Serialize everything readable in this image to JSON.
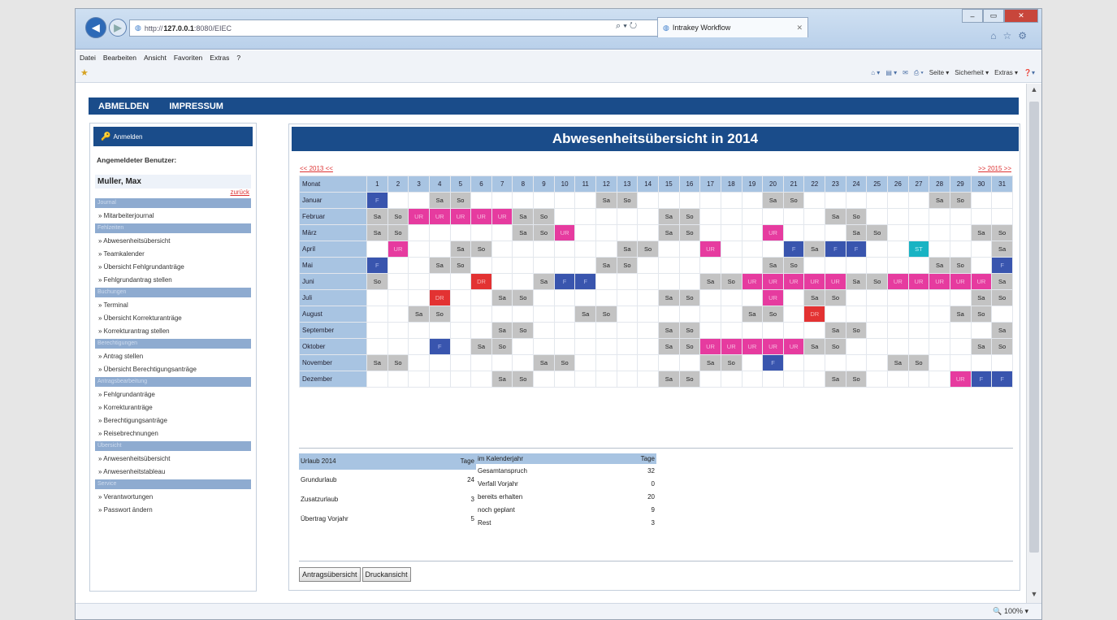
{
  "browser": {
    "url_prefix": "http://",
    "url_host": "127.0.0.1",
    "url_path": ":8080/EIEC",
    "tab_title": "Intrakey Workflow",
    "zoom": "100%"
  },
  "menu": [
    "Datei",
    "Bearbeiten",
    "Ansicht",
    "Favoriten",
    "Extras",
    "?"
  ],
  "commandbar": [
    "Seite ▾",
    "Sicherheit ▾",
    "Extras ▾"
  ],
  "topnav": [
    "ABMELDEN",
    "IMPRESSUM"
  ],
  "sidebar": {
    "header": "Anmelden",
    "user_label": "Angemeldeter Benutzer:",
    "user_name": "Muller, Max",
    "back_link": "zurück",
    "sections": [
      {
        "title": "Journal",
        "items": [
          "Mitarbeiterjournal"
        ]
      },
      {
        "title": "Fehlzeiten",
        "items": [
          "Abwesenheitsübersicht",
          "Teamkalender",
          "Übersicht Fehlgrundanträge",
          "Fehlgrundantrag stellen"
        ]
      },
      {
        "title": "Buchungen",
        "items": [
          "Terminal",
          "Übersicht Korrekturanträge",
          "Korrekturantrag stellen"
        ]
      },
      {
        "title": "Berechtigungen",
        "items": [
          "Antrag stellen",
          "Übersicht Berechtigungsanträge"
        ]
      },
      {
        "title": "Antragsbearbeitung",
        "items": [
          "Fehlgrundanträge",
          "Korrekturanträge",
          "Berechtigungsanträge",
          "Reisebrechnungen"
        ]
      },
      {
        "title": "Übersicht",
        "items": [
          "Anwesenheitsübersicht",
          "Anwesenheitstableau"
        ]
      },
      {
        "title": "Service",
        "items": [
          "Verantwortungen",
          "Passwort ändern"
        ]
      }
    ]
  },
  "main": {
    "title": "Abwesenheitsübersicht in 2014",
    "prev_year": "<< 2013 <<",
    "next_year": ">> 2015 >>",
    "month_header": "Monat",
    "days": [
      "1",
      "2",
      "3",
      "4",
      "5",
      "6",
      "7",
      "8",
      "9",
      "10",
      "11",
      "12",
      "13",
      "14",
      "15",
      "16",
      "17",
      "18",
      "19",
      "20",
      "21",
      "22",
      "23",
      "24",
      "25",
      "26",
      "27",
      "28",
      "29",
      "30",
      "31"
    ],
    "codes": {
      "S": "Sa",
      "U": "So",
      "R": "UR",
      "F": "F",
      "D": "DR",
      "T": "ST"
    },
    "months": [
      {
        "name": "Januar",
        "days": "F..SU......SU......SU......SU.."
      },
      {
        "name": "Februar",
        "days": "SURRRRRSU.....SU......SU...###"
      },
      {
        "name": "März",
        "days": "SU.....SUR....SU...R...SU....SU."
      },
      {
        "name": "April",
        "days": ".R..SU......SU..R...FSFF..T...SU.#"
      },
      {
        "name": "Mai",
        "days": "F..SU......SU......SU......SU.F..S"
      },
      {
        "name": "Juni",
        "days": "U....D..SFF.....SURRRRRSURRRRRSU#"
      },
      {
        "name": "Juli",
        "days": "...D..SU......SU...R.SU......SU..."
      },
      {
        "name": "August",
        "days": "..SU......SU......SU.D......SU...SU"
      },
      {
        "name": "September",
        "days": "......SU......SU......SU......SU#"
      },
      {
        "name": "Oktober",
        "days": "...F.SU.......SURRRRRSU......SU...F"
      },
      {
        "name": "November",
        "days": "SU......SU......SU.F.....SU.....SU#"
      },
      {
        "name": "Dezember",
        "days": "......SU......SU......SU....RFFSURRR"
      }
    ],
    "summary_left": {
      "header": "Urlaub 2014",
      "unit": "Tage",
      "rows": [
        [
          "Grundurlaub",
          "24"
        ],
        [
          "Zusatzurlaub",
          "3"
        ],
        [
          "Übertrag Vorjahr",
          "5"
        ]
      ]
    },
    "summary_right": {
      "header": "im Kalenderjahr",
      "unit": "Tage",
      "rows": [
        [
          "Gesamtanspruch",
          "32"
        ],
        [
          "Verfall Vorjahr",
          "0"
        ],
        [
          "bereits erhalten",
          "20"
        ],
        [
          "noch geplant",
          "9"
        ],
        [
          "Rest",
          "3"
        ]
      ]
    },
    "buttons": [
      "Antragsübersicht",
      "Druckansicht"
    ]
  }
}
